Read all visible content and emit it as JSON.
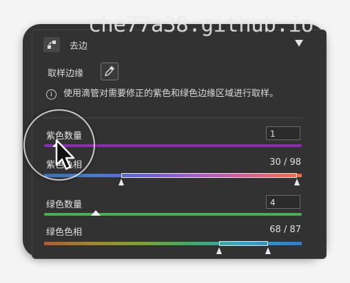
{
  "watermark": "che77a38.github.io",
  "panel": {
    "title": "去边",
    "collapse_icon": "triangle-down-icon",
    "header_icon": "defringe-icon"
  },
  "sampling": {
    "label": "取样边缘",
    "tool_icon": "eyedropper-icon"
  },
  "info": {
    "icon": "info-icon",
    "text": "使用滴管对需要修正的紫色和绿色边缘区域进行取样。"
  },
  "purple_amount": {
    "label": "紫色数量",
    "value": "1",
    "level": 0.05
  },
  "purple_hue": {
    "label": "紫色色相",
    "value": "30 / 98",
    "range": [
      30,
      98
    ]
  },
  "green_amount": {
    "label": "绿色数量",
    "value": "4",
    "level": 0.2
  },
  "green_hue": {
    "label": "绿色色相",
    "value": "68 / 87",
    "range": [
      68,
      87
    ]
  },
  "colors": {
    "panel_bg": "#323232",
    "purple_track": "#8e2bb8",
    "green_track": "#4caf50"
  }
}
